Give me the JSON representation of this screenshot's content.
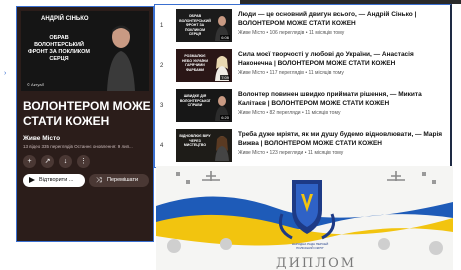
{
  "playlist": {
    "thumb_name": "АНДРІЙ СІНЬКО",
    "thumb_title": "ОБРАВ ВОЛОНТЕРСЬКИЙ ФРОНТ ЗА ПОКЛИКОМ СЕРЦЯ",
    "thumb_logo": "© АктуаЛ",
    "title": "ВОЛОНТЕРОМ МОЖЕ СТАТИ КОЖЕН",
    "channel": "Живе Місто",
    "meta": "13 відео  335 переглядів  Останнє оновлення: 9 лип...",
    "play_label": "Відтворити ...",
    "shuffle_label": "Перемішати",
    "icons": [
      "add-icon",
      "share-icon",
      "download-icon",
      "more-icon"
    ]
  },
  "videos": [
    {
      "index": "1",
      "thumb_text": "ОБРАВ ВОЛОНТЕРСЬКИЙ ФРОНТ ЗА ПОКЛИКОМ СЕРЦЯ",
      "duration": "6:06",
      "title": "Люди — це основний двигун всього, — Андрій Сінько | ВОЛОНТЕРОМ МОЖЕ СТАТИ КОЖЕН",
      "meta": "Живе Місто • 106 переглядів • 11 місяців тому"
    },
    {
      "index": "2",
      "thumb_text": "РОЗМАЛЮЄ НЕБО УКРАЇНИ ГАРЯЧИМИ ФАРБАМИ",
      "duration": "7:09",
      "title": "Сила моєї творчості у любові до України, — Анастасія Наконечна | ВОЛОНТЕРОМ МОЖЕ СТАТИ КОЖЕН",
      "meta": "Живе Місто • 117 переглядів • 11 місяців тому"
    },
    {
      "index": "3",
      "thumb_text": "ШВИДКЕ ДІЯ ВОЛОНТЕРСЬКОЇ СПРАВИ",
      "duration": "6:20",
      "title": "Волонтер повинен швидко приймати рішення, — Микита Калітаєв | ВОЛОНТЕРОМ МОЖЕ СТАТИ КОЖЕН",
      "meta": "Живе Місто • 82 перегляди • 11 місяців тому"
    },
    {
      "index": "4",
      "thumb_text": "ВІДНОВЛЮЄ ВІРУ ЧЕРЕЗ МИСТЕЦТВО",
      "duration": "",
      "title": "Треба дуже мріяти, як ми душу будемо відновлювати, — Марія Вижва | ВОЛОНТЕРОМ МОЖЕ СТАТИ КОЖЕН",
      "meta": "Живе Місто • 123 перегляди • 11 місяців тому"
    }
  ],
  "diploma": {
    "emblem_text": "НАРОДНА РАДА ПЕРСЕЙ ПОЛІСЬКИЙ ОКРУГ",
    "title": "ДИПЛОМ"
  },
  "colors": {
    "panel_bg": "#2b1d1a",
    "border_accent": "#3a6fd0",
    "flag_blue": "#1e5bb8",
    "flag_yellow": "#f2c40f"
  }
}
